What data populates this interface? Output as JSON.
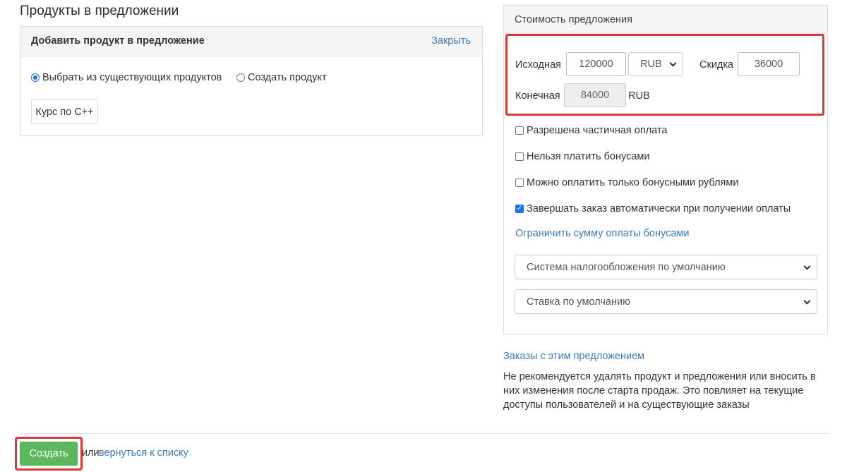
{
  "page_title": "Продукты в предложении",
  "products_panel": {
    "title": "Добавить продукт в предложение",
    "close_label": "Закрыть",
    "radio_options": [
      {
        "label": "Выбрать из существующих продуктов",
        "checked": true
      },
      {
        "label": "Создать продукт",
        "checked": false
      }
    ],
    "selected_product": "Курс по С++"
  },
  "price_panel": {
    "title": "Стоимость предложения",
    "initial_label": "Исходная",
    "initial_value": "120000",
    "currency": "RUB",
    "discount_label": "Скидка",
    "discount_value": "36000",
    "final_label": "Конечная",
    "final_value": "84000",
    "final_currency": "RUB",
    "checkboxes": [
      {
        "label": "Разрешена частичная оплата",
        "checked": false
      },
      {
        "label": "Нельзя платить бонусами",
        "checked": false
      },
      {
        "label": "Можно оплатить только бонусными рублями",
        "checked": false
      },
      {
        "label": "Завершать заказ автоматически при получении оплаты",
        "checked": true
      }
    ],
    "bonus_limit_link": "Ограничить сумму оплаты бонусами",
    "tax_system_select": "Система налогообложения по умолчанию",
    "vat_rate_select": "Ставка по умолчанию"
  },
  "orders_link": "Заказы с этим предложением",
  "warning_text": "Не рекомендуется удалять продукт и предложения или вносить в них изменения после старта продаж. Это повлияет на текущие доступы пользователей и на существующие заказы",
  "footer": {
    "create_label": "Создать",
    "or_text": "или",
    "back_link": "вернуться к списку"
  },
  "colors": {
    "link": "#3b7bbf",
    "primary_button": "#5cb85c",
    "highlight": "#d9383c",
    "checkbox_checked": "#1a73e8"
  }
}
